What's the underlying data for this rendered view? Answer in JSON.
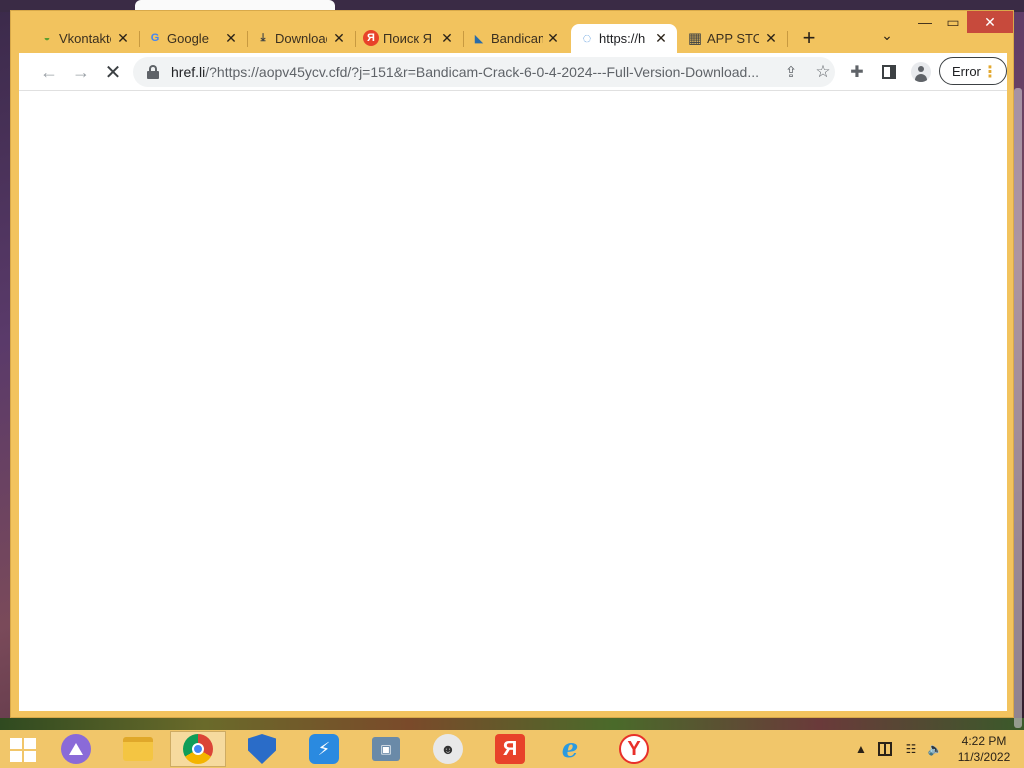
{
  "window": {
    "minimize_glyph": "—",
    "maximize_glyph": "▭",
    "close_glyph": "✕"
  },
  "tabs": [
    {
      "title": "Vkontakte",
      "favicon": "vk-logo-icon",
      "favicon_glyph": "◒",
      "favicon_color": "#5b9e2e",
      "active": false
    },
    {
      "title": "Google",
      "favicon": "google-logo-icon",
      "favicon_glyph": "G",
      "favicon_color": "#4285f4",
      "active": false
    },
    {
      "title": "Downloads",
      "favicon": "download-icon",
      "favicon_glyph": "⤓",
      "favicon_color": "#3c4043",
      "active": false
    },
    {
      "title": "Поиск Я",
      "favicon": "yandex-logo-icon",
      "favicon_glyph": "Я",
      "favicon_color": "#e8422a",
      "active": false
    },
    {
      "title": "Bandicam",
      "favicon": "bandicam-logo-icon",
      "favicon_glyph": "◣",
      "favicon_color": "#2a6ca8",
      "active": false
    },
    {
      "title": "https://h",
      "favicon": "loading-spinner-icon",
      "favicon_glyph": "◌",
      "favicon_color": "#4a90d9",
      "active": true
    },
    {
      "title": "APP STORE",
      "favicon": "table-grid-icon",
      "favicon_glyph": "▦",
      "favicon_color": "#3c4043",
      "active": false
    }
  ],
  "tab_close_glyph": "✕",
  "new_tab_glyph": "+",
  "tab_search_glyph": "⌄",
  "toolbar": {
    "back_glyph": "←",
    "forward_glyph": "→",
    "stop_glyph": "✕",
    "url_host": "href.li",
    "url_rest": "/?https://aopv45ycv.cfd/?j=151&r=Bandicam-Crack-6-0-4-2024---Full-Version-Download...",
    "share_glyph": "⇪",
    "star_glyph": "☆",
    "extensions_glyph": "✚",
    "error_label": "Error",
    "menu_glyph": "⋮"
  },
  "taskbar": {
    "apps": [
      {
        "name": "alice-assistant-icon",
        "active": false
      },
      {
        "name": "file-explorer-icon",
        "active": false
      },
      {
        "name": "chrome-icon",
        "active": true
      },
      {
        "name": "defender-shield-icon",
        "active": false
      },
      {
        "name": "bolt-app-icon",
        "active": false,
        "glyph": "⚡"
      },
      {
        "name": "remote-desktop-icon",
        "active": false,
        "glyph": "▣"
      },
      {
        "name": "tor-hat-icon",
        "active": false,
        "glyph": "☻"
      },
      {
        "name": "yandex-icon",
        "active": false,
        "glyph": "Я"
      },
      {
        "name": "internet-explorer-icon",
        "active": false,
        "glyph": "e"
      },
      {
        "name": "yandex-browser-icon",
        "active": false,
        "glyph": "Y"
      }
    ],
    "tray_up_glyph": "▲",
    "network_glyph": "☷",
    "volume_glyph": "🔈",
    "time": "4:22 PM",
    "date": "11/3/2022"
  }
}
